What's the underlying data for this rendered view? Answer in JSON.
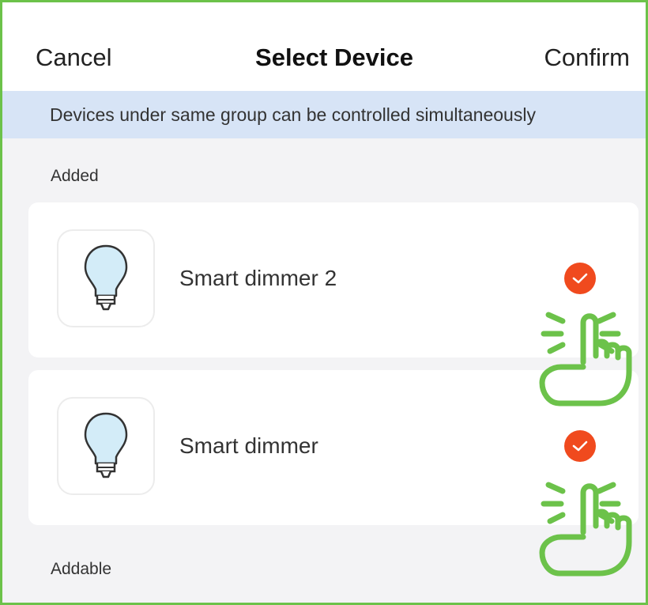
{
  "header": {
    "cancel_label": "Cancel",
    "title": "Select Device",
    "confirm_label": "Confirm"
  },
  "banner": {
    "text": "Devices under same group can be controlled simultaneously"
  },
  "sections": {
    "added_label": "Added",
    "addable_label": "Addable"
  },
  "devices": [
    {
      "name": "Smart dimmer 2",
      "icon": "light-bulb-icon",
      "selected": true
    },
    {
      "name": "Smart dimmer",
      "icon": "light-bulb-icon",
      "selected": true
    }
  ],
  "colors": {
    "accent_check": "#f04a1e",
    "banner_bg": "#d7e4f6",
    "annotation_green": "#6cc24a",
    "bulb_fill": "#d3ecf8"
  },
  "annotations": {
    "icon": "tap-hand-icon"
  }
}
